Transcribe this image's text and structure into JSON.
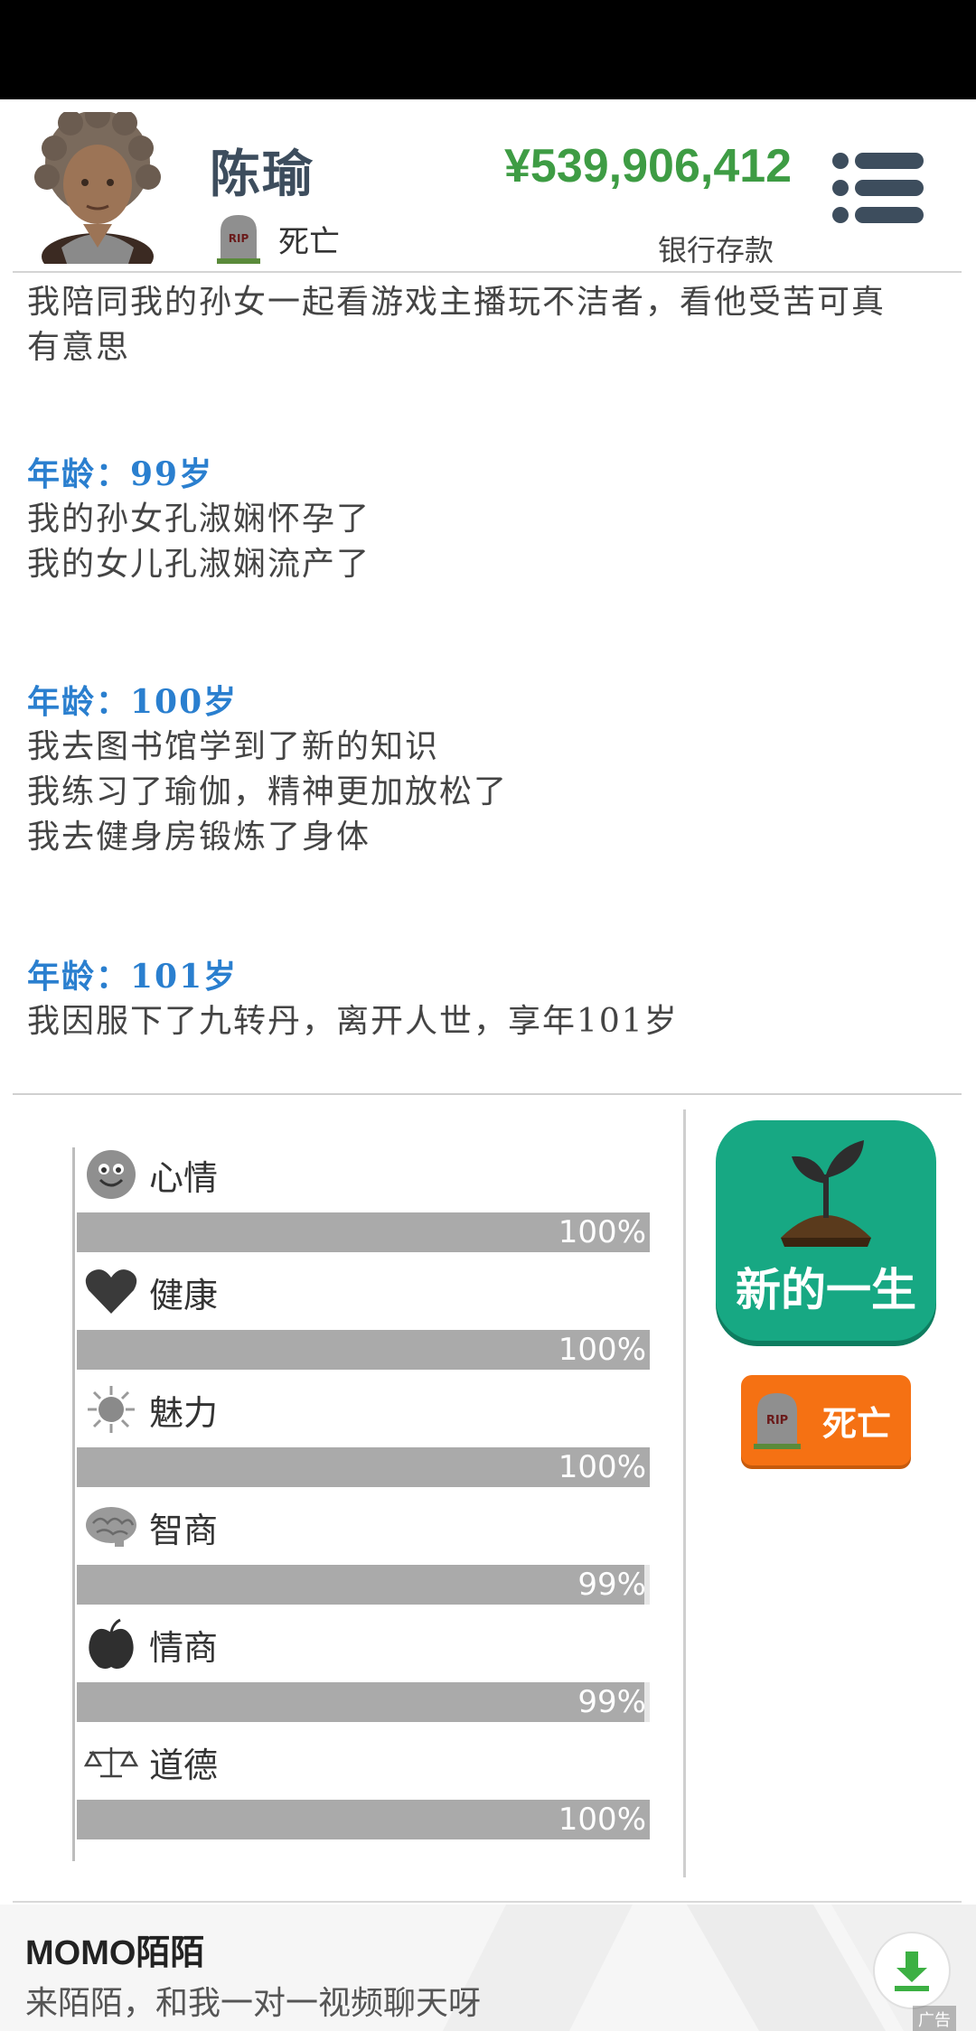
{
  "header": {
    "name": "陈瑜",
    "status": "死亡",
    "money": "¥539,906,412",
    "money_label": "银行存款"
  },
  "log": {
    "first_lines": [
      "我陪同我的孙女一起看游戏主播玩不洁者，看他受苦可真",
      "有意思"
    ],
    "entries": [
      {
        "age": "年龄：99岁",
        "lines": [
          "我的孙女孔淑娴怀孕了",
          "我的女儿孔淑娴流产了"
        ]
      },
      {
        "age": "年龄：100岁",
        "lines": [
          "我去图书馆学到了新的知识",
          "我练习了瑜伽，精神更加放松了",
          "我去健身房锻炼了身体"
        ]
      },
      {
        "age": "年龄：101岁",
        "lines": [
          "我因服下了九转丹，离开人世，享年101岁"
        ]
      }
    ]
  },
  "stats": [
    {
      "label": "心情",
      "value": 100,
      "text": "100%",
      "icon": "smiley-icon"
    },
    {
      "label": "健康",
      "value": 100,
      "text": "100%",
      "icon": "heart-icon"
    },
    {
      "label": "魅力",
      "value": 100,
      "text": "100%",
      "icon": "sun-icon"
    },
    {
      "label": "智商",
      "value": 99,
      "text": "99%",
      "icon": "brain-icon"
    },
    {
      "label": "情商",
      "value": 99,
      "text": "99%",
      "icon": "apple-icon"
    },
    {
      "label": "道德",
      "value": 100,
      "text": "100%",
      "icon": "scales-icon"
    }
  ],
  "actions": {
    "new_life_label": "新的一生",
    "die_label": "死亡"
  },
  "ad": {
    "title": "MOMO陌陌",
    "description": "来陌陌，和我一对一视频聊天呀",
    "tag": "广告"
  },
  "colors": {
    "money": "#3e9c44",
    "age": "#2a7fcf",
    "new_life": "#17a883",
    "die": "#f57113",
    "bar": "#aaaaaa"
  }
}
